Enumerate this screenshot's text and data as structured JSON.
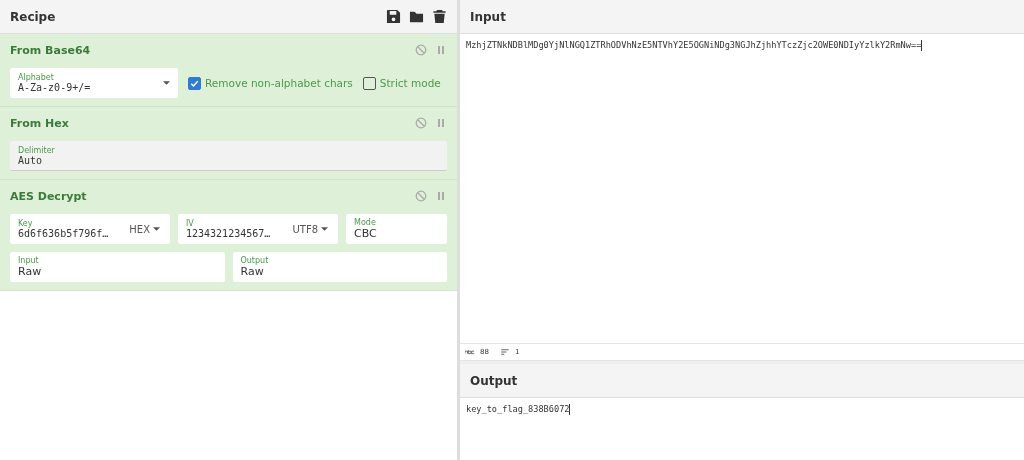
{
  "recipe": {
    "title": "Recipe",
    "operations": [
      {
        "name": "From Base64",
        "disabled": false,
        "paused": false,
        "rows": [
          [
            {
              "kind": "select",
              "label": "Alphabet",
              "value": "A-Za-z0-9+/=",
              "grey": false
            },
            {
              "kind": "checkbox",
              "label": "Remove non-alphabet chars",
              "checked": true
            },
            {
              "kind": "checkbox",
              "label": "Strict mode",
              "checked": false
            }
          ]
        ]
      },
      {
        "name": "From Hex",
        "disabled": false,
        "paused": false,
        "rows": [
          [
            {
              "kind": "select",
              "label": "Delimiter",
              "value": "Auto",
              "grey": true
            }
          ]
        ]
      },
      {
        "name": "AES Decrypt",
        "disabled": false,
        "paused": false,
        "rows": [
          [
            {
              "kind": "toggle",
              "label": "Key",
              "value": "6d6f636b5f796f…",
              "option": "HEX"
            },
            {
              "kind": "toggle",
              "label": "IV",
              "value": "1234321234567…",
              "option": "UTF8"
            },
            {
              "kind": "text",
              "label": "Mode",
              "value": "CBC"
            }
          ],
          [
            {
              "kind": "text",
              "label": "Input",
              "value": "Raw"
            },
            {
              "kind": "text",
              "label": "Output",
              "value": "Raw"
            }
          ]
        ]
      }
    ]
  },
  "input": {
    "title": "Input",
    "text": "MzhjZTNkNDBlMDg0YjNlNGQ1ZTRhODVhNzE5NTVhY2E5OGNiNDg3NGJhZjhhYTczZjc2OWE0NDIyYzlkY2RmNw==",
    "length": "88",
    "lines": "1"
  },
  "output": {
    "title": "Output",
    "text": "key_to_flag_838B6072"
  }
}
